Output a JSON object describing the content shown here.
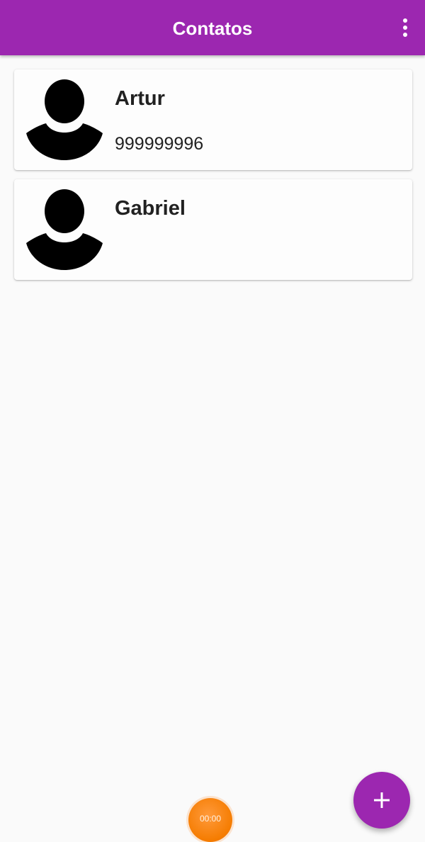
{
  "app_bar": {
    "title": "Contatos",
    "menu_icon": "more-vert-icon",
    "color": "#9c27b0"
  },
  "contacts": [
    {
      "name": "Artur",
      "phone": "999999996",
      "avatar_icon": "person-avatar-icon"
    },
    {
      "name": "Gabriel",
      "phone": "",
      "avatar_icon": "person-avatar-icon"
    }
  ],
  "recorder": {
    "time": "00:00",
    "color": "#f57c00"
  },
  "fab": {
    "icon": "add-icon",
    "color": "#9c27b0"
  }
}
